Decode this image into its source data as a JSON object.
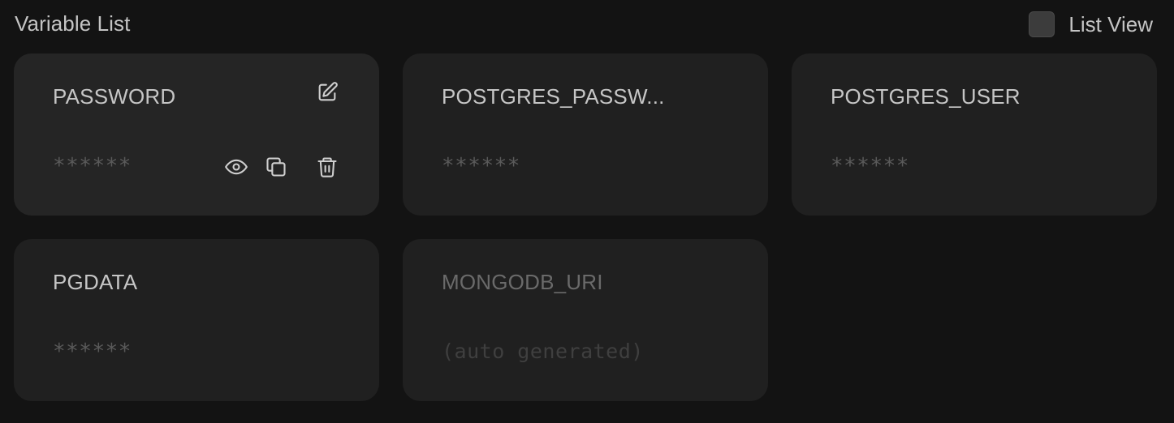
{
  "header": {
    "title": "Variable List",
    "list_view_label": "List View",
    "list_view_checked": false
  },
  "variables": [
    {
      "name": "PASSWORD",
      "value": "******",
      "hovered": true
    },
    {
      "name": "POSTGRES_PASSW...",
      "value": "******"
    },
    {
      "name": "POSTGRES_USER",
      "value": "******"
    },
    {
      "name": "PGDATA",
      "value": "******"
    },
    {
      "name": "MONGODB_URI",
      "value": "(auto generated)",
      "disabled": true
    }
  ],
  "icons": {
    "edit": "edit-icon",
    "reveal": "eye-icon",
    "copy": "copy-icon",
    "delete": "trash-icon"
  }
}
